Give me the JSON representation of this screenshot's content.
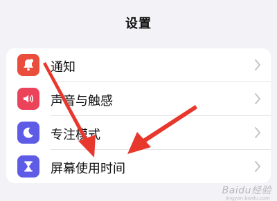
{
  "header": {
    "title": "设置"
  },
  "rows": [
    {
      "label": "通知",
      "icon": "notifications-icon",
      "color": "#eb4d3d"
    },
    {
      "label": "声音与触感",
      "icon": "sound-icon",
      "color": "#eb445a"
    },
    {
      "label": "专注模式",
      "icon": "moon-icon",
      "color": "#5e5ce6"
    },
    {
      "label": "屏幕使用时间",
      "icon": "hourglass-icon",
      "color": "#5e5ce6"
    }
  ],
  "watermark": {
    "text": "Baidu经验",
    "sub": "jingyan.baidu.com"
  },
  "colors": {
    "arrow": "#e8372c",
    "background": "#f2f2f7"
  }
}
